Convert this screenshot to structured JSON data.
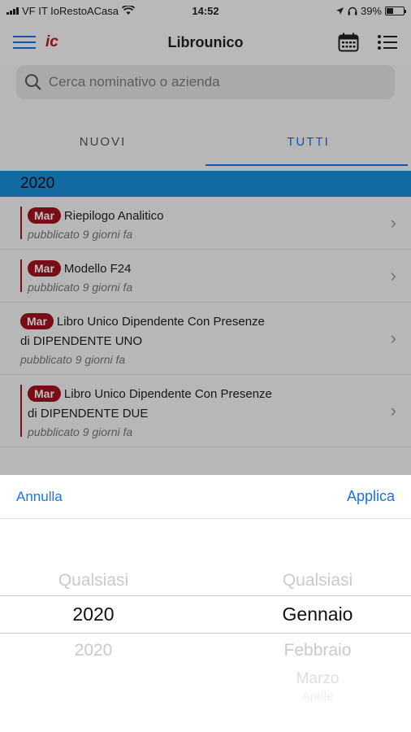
{
  "status_bar": {
    "carrier": "VF IT IoRestoACasa",
    "time": "14:52",
    "battery": "39%",
    "battery_level": 0.39
  },
  "navbar": {
    "logo": "ic",
    "title": "Librounico",
    "calendar_icon": "calendar-icon",
    "menu_icon": "hamburger-menu-icon",
    "list_icon": "list-icon"
  },
  "search": {
    "placeholder": "Cerca nominativo o azienda"
  },
  "tabs": [
    {
      "label": "NUOVI",
      "active": false
    },
    {
      "label": "TUTTI",
      "active": true
    }
  ],
  "year_header": "2020",
  "documents": [
    {
      "badge": "Mar",
      "title": "Riepilogo Analitico",
      "subtitle": "pubblicato 9 giorni fa",
      "marked": true
    },
    {
      "badge": "Mar",
      "title": "Modello F24",
      "subtitle": "pubblicato 9 giorni fa",
      "marked": true
    },
    {
      "badge": "Mar",
      "title": "Libro Unico Dipendente Con Presenze",
      "title_line2": "di DIPENDENTE UNO",
      "subtitle": "pubblicato 9 giorni fa",
      "marked": false
    },
    {
      "badge": "Mar",
      "title": "Libro Unico Dipendente Con Presenze",
      "title_line2": "di DIPENDENTE DUE",
      "subtitle": "pubblicato 9 giorni fa",
      "marked": true
    }
  ],
  "picker_sheet": {
    "cancel_label": "Annulla",
    "apply_label": "Applica",
    "year_column": {
      "above": "Qualsiasi",
      "selected": "2020",
      "below": "2020"
    },
    "month_column": {
      "above": "Qualsiasi",
      "selected": "Gennaio",
      "below": [
        "Febbraio",
        "Marzo",
        "Aprile"
      ]
    }
  }
}
